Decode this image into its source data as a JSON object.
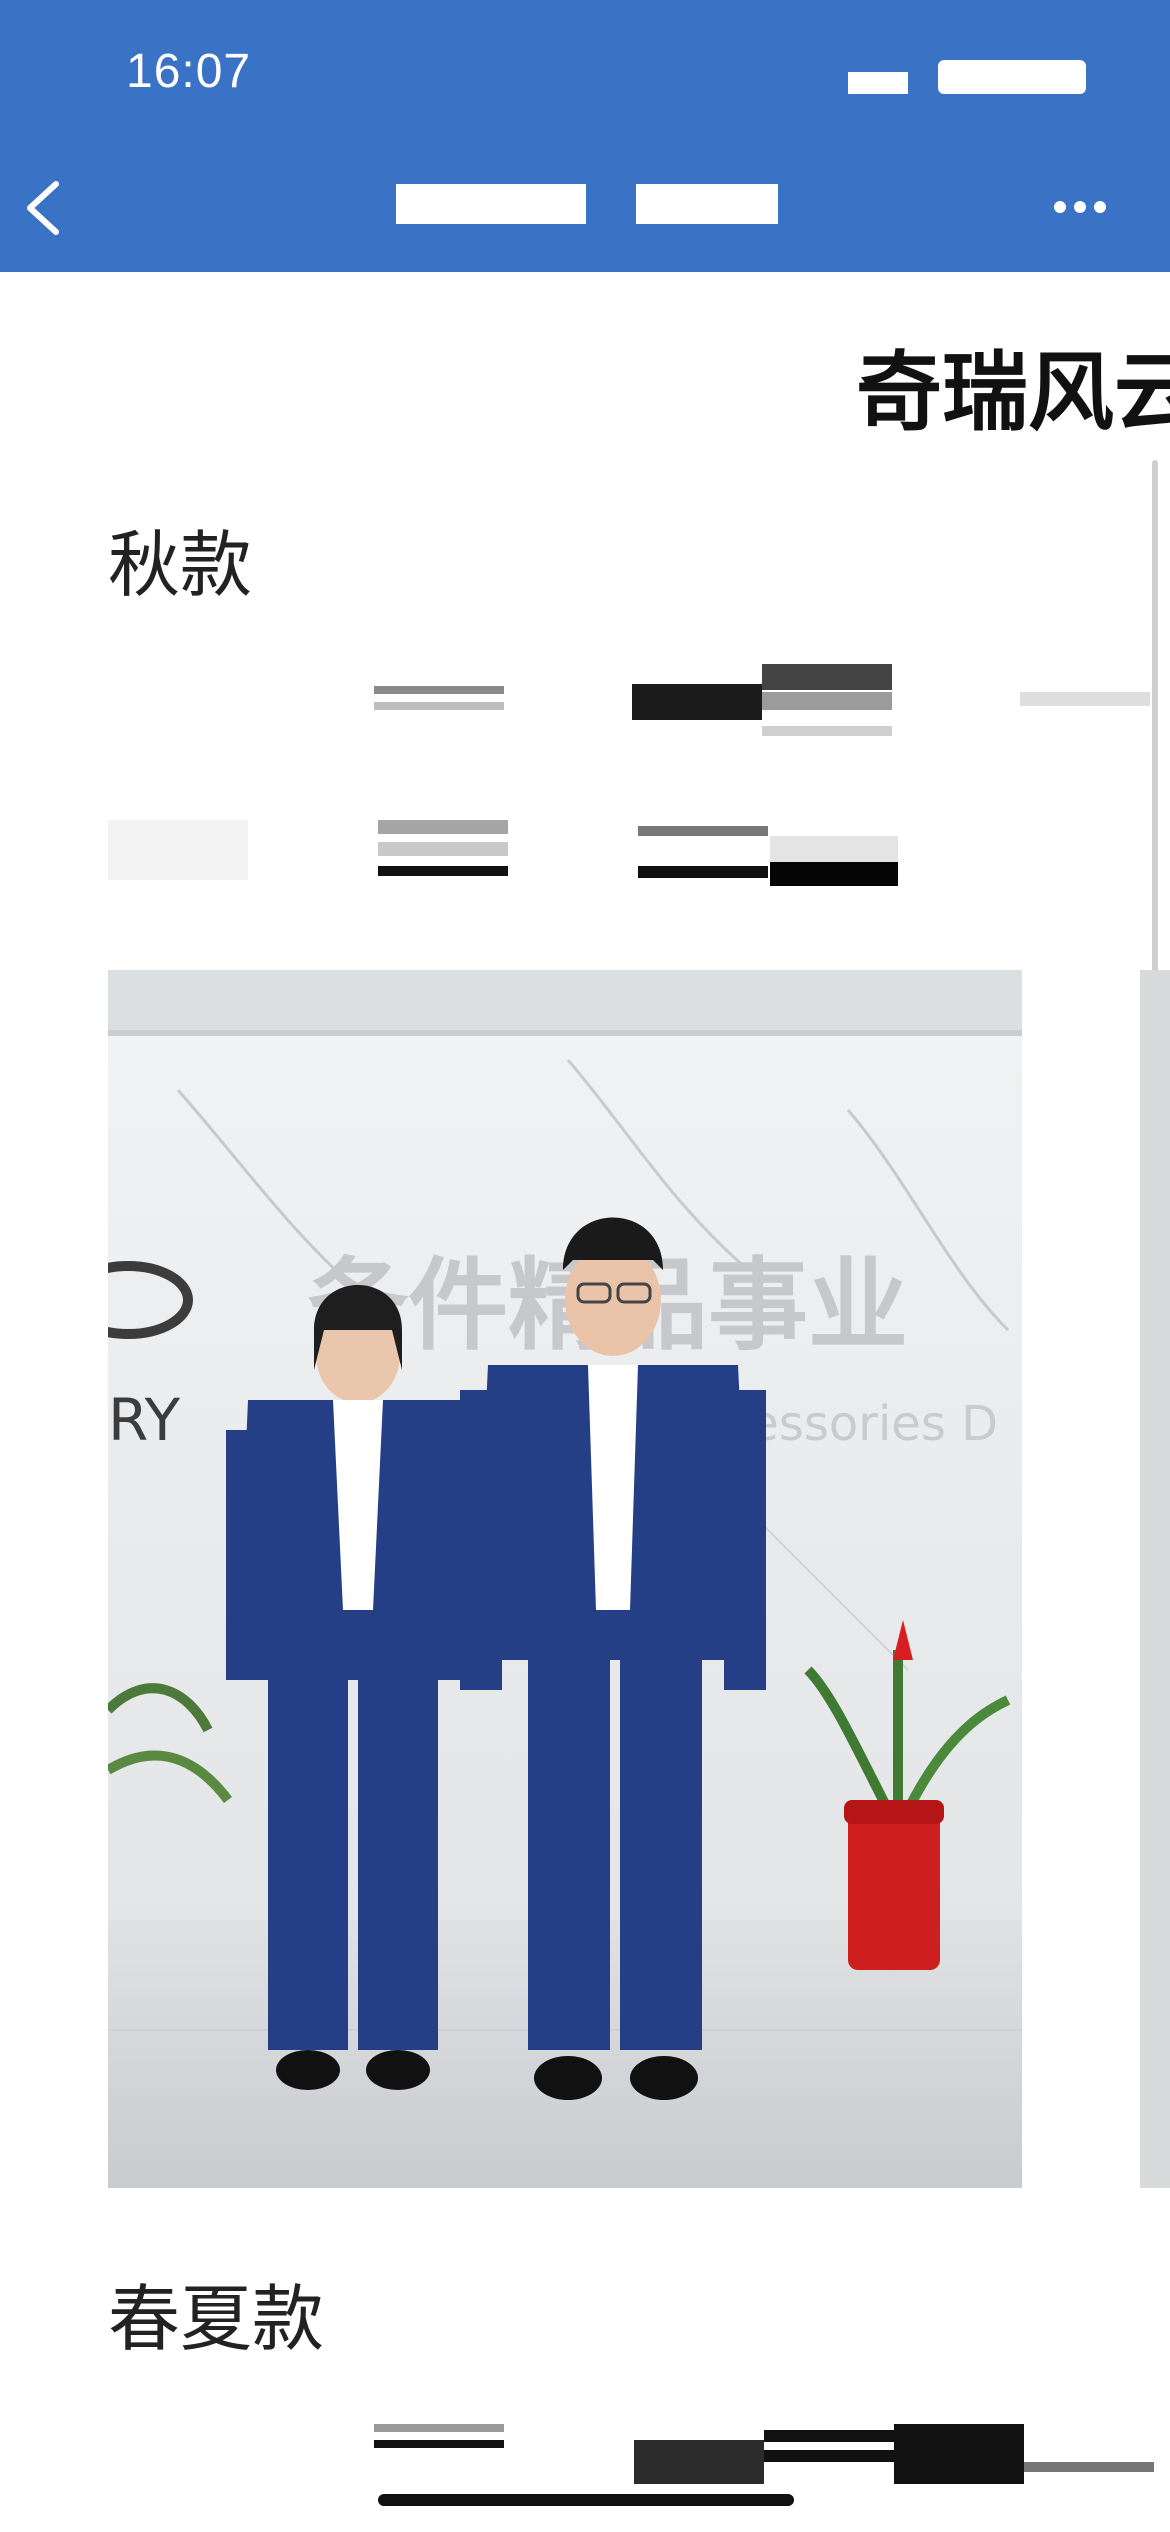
{
  "status_bar": {
    "time": "16:07"
  },
  "nav_bar": {
    "back_icon": "chevron-left-icon",
    "more_icon": "more-horizontal-icon"
  },
  "article": {
    "title": "奇瑞风云",
    "sections": [
      {
        "heading": "秋款"
      },
      {
        "heading": "春夏款"
      }
    ],
    "photo": {
      "sign_text": "备件精品事业",
      "sign_subtext": "Spare Parts & Accessories D",
      "brand_text": "RY"
    }
  },
  "colors": {
    "accent": "#3a72c6",
    "suit": "#243f86"
  }
}
